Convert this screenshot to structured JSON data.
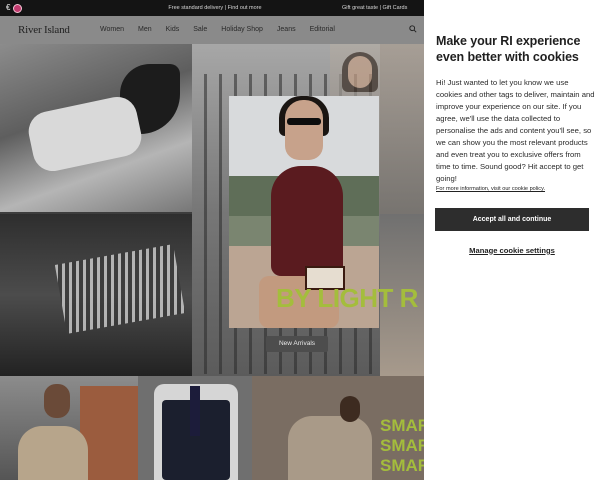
{
  "topbar": {
    "currency_symbol": "€",
    "delivery_text": "Free standard delivery | Find out more",
    "right_text": "Gift great taste | Gift Cards"
  },
  "nav": {
    "logo": "River Island",
    "items": [
      "Women",
      "Men",
      "Kids",
      "Sale",
      "Holiday Shop",
      "Jeans",
      "Editorial"
    ],
    "search_icon": "search-icon"
  },
  "hero": {
    "headline": "BY LIGHT R",
    "cta_label": "New Arrivals",
    "accent_color": "#a4bd3c"
  },
  "row2": {
    "smart_lines": [
      "SMAR",
      "SMAR",
      "SMAR"
    ]
  },
  "cookie": {
    "title": "Make your RI experience even better with cookies",
    "body": "Hi! Just wanted to let you know we use cookies and other tags to deliver, maintain and improve your experience on our site. If you agree, we'll use the data collected to personalise the ads and content you'll see, so we can show you the most relevant products and even treat you to exclusive offers from time to time. Sound good? Hit accept to get going!",
    "policy_link": "For more information, visit our cookie policy.",
    "accept_label": "Accept all and continue",
    "manage_label": "Manage cookie settings"
  }
}
